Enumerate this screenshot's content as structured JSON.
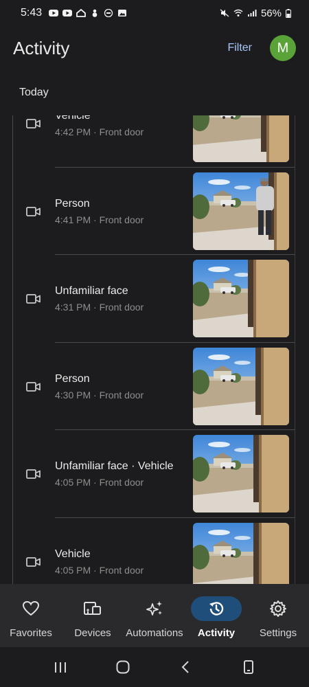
{
  "status_bar": {
    "time": "5:43",
    "battery": "56%"
  },
  "header": {
    "title": "Activity",
    "filter_label": "Filter",
    "avatar_initial": "M",
    "avatar_color": "#5aa338"
  },
  "section": {
    "label": "Today"
  },
  "events": [
    {
      "label": "Vehicle",
      "time": "4:42 PM",
      "location": "Front door"
    },
    {
      "label": "Person",
      "time": "4:41 PM",
      "location": "Front door"
    },
    {
      "label": "Unfamiliar face",
      "time": "4:31 PM",
      "location": "Front door"
    },
    {
      "label": "Person",
      "time": "4:30 PM",
      "location": "Front door"
    },
    {
      "label": "Unfamiliar face · Vehicle",
      "time": "4:05 PM",
      "location": "Front door"
    },
    {
      "label": "Vehicle",
      "time": "4:05 PM",
      "location": "Front door"
    }
  ],
  "nav": {
    "items": [
      {
        "label": "Favorites",
        "icon": "heart-icon"
      },
      {
        "label": "Devices",
        "icon": "devices-icon"
      },
      {
        "label": "Automations",
        "icon": "sparkle-icon"
      },
      {
        "label": "Activity",
        "icon": "history-icon",
        "active": true
      },
      {
        "label": "Settings",
        "icon": "gear-icon"
      }
    ],
    "active_color": "#1f4e7a"
  }
}
